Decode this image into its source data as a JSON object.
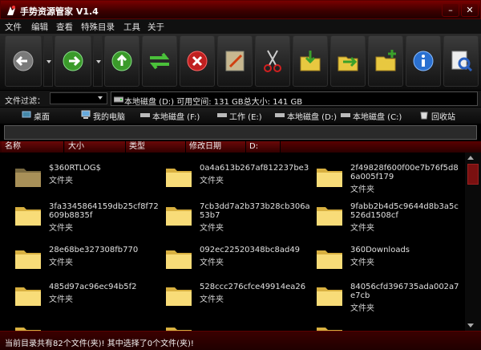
{
  "app": {
    "title": "手势资源管家 V1.4"
  },
  "menu": [
    "文件",
    "编辑",
    "查看",
    "特殊目录",
    "工具",
    "关于"
  ],
  "toolbar": {
    "buttons": [
      "back",
      "forward",
      "up",
      "refresh",
      "delete",
      "rename",
      "cut",
      "copy-to",
      "move-to",
      "new-folder",
      "info",
      "search"
    ]
  },
  "filter": {
    "label": "文件过滤：",
    "value": ""
  },
  "drive_info": {
    "text": "本地磁盘 (D:)    可用空间: 131 GB总大小: 141 GB"
  },
  "locations": [
    {
      "label": "桌面",
      "icon": "desktop-icon"
    },
    {
      "label": "我的电脑",
      "icon": "computer-icon"
    },
    {
      "label": "本地磁盘 (F:)",
      "icon": "drive-icon"
    },
    {
      "label": "工作 (E:)",
      "icon": "drive-icon"
    },
    {
      "label": "本地磁盘 (D:)",
      "icon": "drive-icon"
    },
    {
      "label": "本地磁盘 (C:)",
      "icon": "drive-icon"
    },
    {
      "label": "回收站",
      "icon": "recycle-bin-icon"
    }
  ],
  "address": {
    "value": ""
  },
  "columns": [
    "名称",
    "大小",
    "类型",
    "修改日期",
    "D:"
  ],
  "files": [
    {
      "name": "$360RTLOG$",
      "type": "文件夹"
    },
    {
      "name": "0a4a613b267af812237be3",
      "type": "文件夹"
    },
    {
      "name": "2f49828f600f00e7b76f5d86a005f179",
      "type": "文件夹"
    },
    {
      "name": "3fa3345864159db25cf8f72609b8835f",
      "type": "文件夹"
    },
    {
      "name": "7cb3dd7a2b373b28cb306a53b7",
      "type": "文件夹"
    },
    {
      "name": "9fabb2b4d5c9644d8b3a5c526d1508cf",
      "type": "文件夹"
    },
    {
      "name": "28e68be327308fb770",
      "type": "文件夹"
    },
    {
      "name": "092ec22520348bc8ad49",
      "type": "文件夹"
    },
    {
      "name": "360Downloads",
      "type": "文件夹"
    },
    {
      "name": "485d97ac96ec94b5f2",
      "type": "文件夹"
    },
    {
      "name": "528ccc276cfce49914ea26",
      "type": "文件夹"
    },
    {
      "name": "84056cfd396735ada002a7e7cb",
      "type": "文件夹"
    }
  ],
  "status": {
    "text": "当前目录共有82个文件(夹)! 其中选择了0个文件(夹)!"
  }
}
